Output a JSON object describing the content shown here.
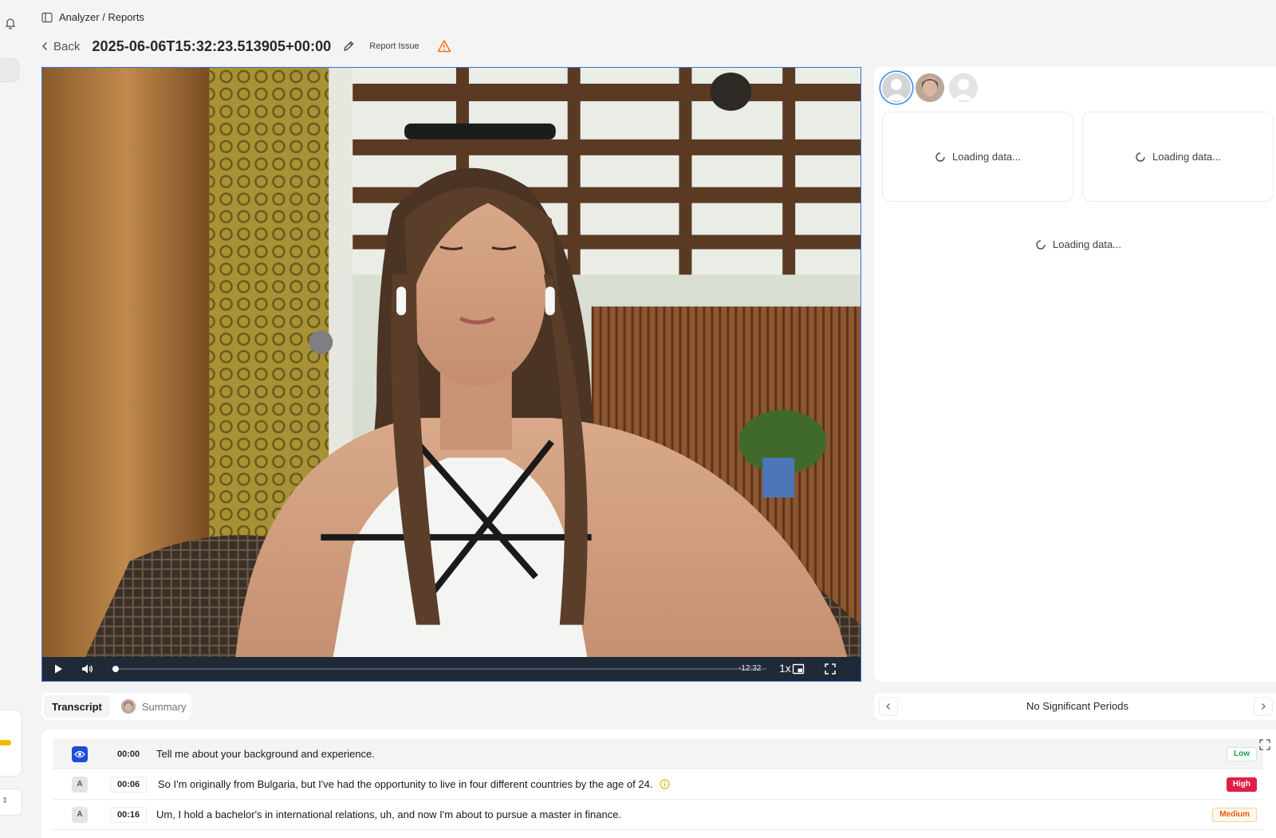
{
  "breadcrumb": {
    "text": "Analyzer / Reports"
  },
  "header": {
    "back_label": "Back",
    "title": "2025-06-06T15:32:23.513905+00:00",
    "report_issue_label": "Report Issue"
  },
  "video": {
    "remaining_time": "-12:32",
    "speed": "1x",
    "progress": 0.0
  },
  "right_panel": {
    "avatars": [
      "avatar-default-selected",
      "avatar-participant-photo",
      "avatar-default"
    ],
    "loading_cards": [
      "Loading data...",
      "Loading data..."
    ],
    "loading_main": "Loading data..."
  },
  "tabs": [
    {
      "label": "Transcript",
      "active": true
    },
    {
      "label": "Summary",
      "active": false
    }
  ],
  "periods": {
    "text": "No Significant Periods"
  },
  "transcript": [
    {
      "speaker": "eye-icon",
      "time": "00:00",
      "text": "Tell me about your background and experience.",
      "level": "Low",
      "info": false
    },
    {
      "speaker": "A",
      "time": "00:06",
      "text": "So I'm originally from Bulgaria, but I've had the opportunity to live in four different countries by the age of 24.",
      "level": "High",
      "info": true
    },
    {
      "speaker": "A",
      "time": "00:16",
      "text": "Um, I hold a bachelor's in international relations, uh, and now I'm about to pursue a master in finance.",
      "level": "Medium",
      "info": false
    }
  ],
  "colors": {
    "accent_blue": "#3b72d9",
    "level_low": "#16a34a",
    "level_high": "#e11d48",
    "level_medium": "#ea580c",
    "warning": "#f97316"
  }
}
